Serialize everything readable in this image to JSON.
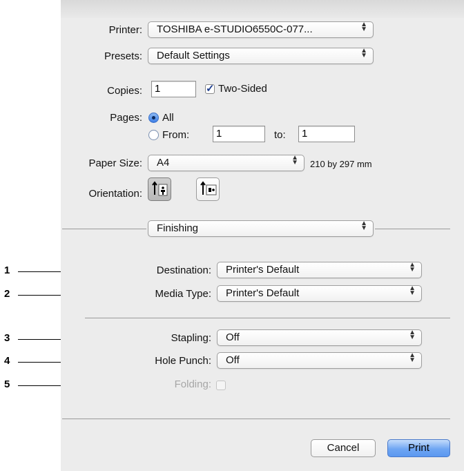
{
  "printer": {
    "label": "Printer:",
    "value": "TOSHIBA e-STUDIO6550C-077..."
  },
  "presets": {
    "label": "Presets:",
    "value": "Default Settings"
  },
  "copies": {
    "label": "Copies:",
    "value": "1",
    "two_sided_label": "Two-Sided",
    "two_sided_checked": true
  },
  "pages": {
    "label": "Pages:",
    "all_label": "All",
    "from_label": "From:",
    "from_value": "1",
    "to_label": "to:",
    "to_value": "1",
    "selected": "All"
  },
  "paper_size": {
    "label": "Paper Size:",
    "value": "A4",
    "dimensions": "210 by 297 mm"
  },
  "orientation": {
    "label": "Orientation:",
    "selected": "portrait"
  },
  "section_popup": {
    "value": "Finishing"
  },
  "destination": {
    "label": "Destination:",
    "value": "Printer's Default"
  },
  "media_type": {
    "label": "Media Type:",
    "value": "Printer's Default"
  },
  "stapling": {
    "label": "Stapling:",
    "value": "Off"
  },
  "hole_punch": {
    "label": "Hole Punch:",
    "value": "Off"
  },
  "folding": {
    "label": "Folding:",
    "checked": false,
    "enabled": false
  },
  "callouts": [
    "1",
    "2",
    "3",
    "4",
    "5"
  ],
  "buttons": {
    "cancel": "Cancel",
    "print": "Print"
  },
  "colors": {
    "accent": "#5a98f0",
    "dialog_bg": "#ececec"
  }
}
